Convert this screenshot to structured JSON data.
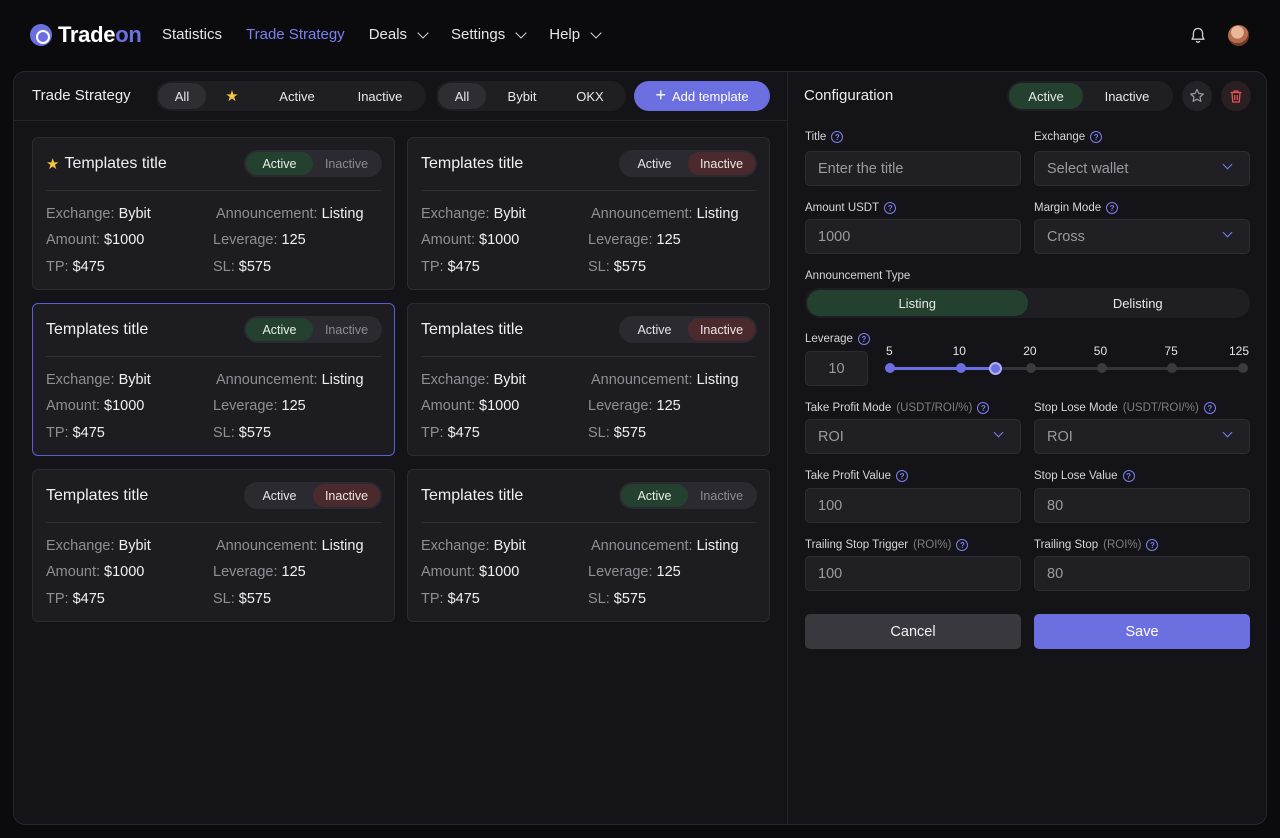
{
  "brand": {
    "name_main": "Trade",
    "name_accent": "on"
  },
  "nav": {
    "items": [
      {
        "label": "Statistics",
        "dropdown": false,
        "active": false
      },
      {
        "label": "Trade Strategy",
        "dropdown": false,
        "active": true
      },
      {
        "label": "Deals",
        "dropdown": true,
        "active": false
      },
      {
        "label": "Settings",
        "dropdown": true,
        "active": false
      },
      {
        "label": "Help",
        "dropdown": true,
        "active": false
      }
    ]
  },
  "strategy": {
    "title": "Trade Strategy",
    "status_filter": {
      "all": "All",
      "active": "Active",
      "inactive": "Inactive"
    },
    "exchange_filter": {
      "all": "All",
      "bybit": "Bybit",
      "okx": "OKX"
    },
    "add_label": "Add template"
  },
  "templates": [
    {
      "title": "Templates title",
      "favorite": true,
      "status": "active",
      "selected": false,
      "exchange_key": "Exchange:",
      "exchange": "Bybit",
      "announcement_key": "Announcement:",
      "announcement": "Listing",
      "amount_key": "Amount:",
      "amount": "$1000",
      "leverage_key": "Leverage:",
      "leverage": "125",
      "tp_key": "TP:",
      "tp": "$475",
      "sl_key": "SL:",
      "sl": "$575",
      "active_label": "Active",
      "inactive_label": "Inactive"
    },
    {
      "title": "Templates title",
      "favorite": false,
      "status": "inactive",
      "selected": false,
      "exchange_key": "Exchange:",
      "exchange": "Bybit",
      "announcement_key": "Announcement:",
      "announcement": "Listing",
      "amount_key": "Amount:",
      "amount": "$1000",
      "leverage_key": "Leverage:",
      "leverage": "125",
      "tp_key": "TP:",
      "tp": "$475",
      "sl_key": "SL:",
      "sl": "$575",
      "active_label": "Active",
      "inactive_label": "Inactive"
    },
    {
      "title": "Templates title",
      "favorite": false,
      "status": "active",
      "selected": true,
      "exchange_key": "Exchange:",
      "exchange": "Bybit",
      "announcement_key": "Announcement:",
      "announcement": "Listing",
      "amount_key": "Amount:",
      "amount": "$1000",
      "leverage_key": "Leverage:",
      "leverage": "125",
      "tp_key": "TP:",
      "tp": "$475",
      "sl_key": "SL:",
      "sl": "$575",
      "active_label": "Active",
      "inactive_label": "Inactive"
    },
    {
      "title": "Templates title",
      "favorite": false,
      "status": "inactive",
      "selected": false,
      "exchange_key": "Exchange:",
      "exchange": "Bybit",
      "announcement_key": "Announcement:",
      "announcement": "Listing",
      "amount_key": "Amount:",
      "amount": "$1000",
      "leverage_key": "Leverage:",
      "leverage": "125",
      "tp_key": "TP:",
      "tp": "$475",
      "sl_key": "SL:",
      "sl": "$575",
      "active_label": "Active",
      "inactive_label": "Inactive"
    },
    {
      "title": "Templates title",
      "favorite": false,
      "status": "inactive",
      "selected": false,
      "exchange_key": "Exchange:",
      "exchange": "Bybit",
      "announcement_key": "Announcement:",
      "announcement": "Listing",
      "amount_key": "Amount:",
      "amount": "$1000",
      "leverage_key": "Leverage:",
      "leverage": "125",
      "tp_key": "TP:",
      "tp": "$475",
      "sl_key": "SL:",
      "sl": "$575",
      "active_label": "Active",
      "inactive_label": "Inactive"
    },
    {
      "title": "Templates title",
      "favorite": false,
      "status": "active",
      "selected": false,
      "exchange_key": "Exchange:",
      "exchange": "Bybit",
      "announcement_key": "Announcement:",
      "announcement": "Listing",
      "amount_key": "Amount:",
      "amount": "$1000",
      "leverage_key": "Leverage:",
      "leverage": "125",
      "tp_key": "TP:",
      "tp": "$475",
      "sl_key": "SL:",
      "sl": "$575",
      "active_label": "Active",
      "inactive_label": "Inactive"
    }
  ],
  "config": {
    "title": "Configuration",
    "status": {
      "active": "Active",
      "inactive": "Inactive"
    },
    "title_label": "Title",
    "title_placeholder": "Enter the title",
    "exchange_label": "Exchange",
    "exchange_placeholder": "Select wallet",
    "amount_label": "Amount USDT",
    "amount_value": "1000",
    "margin_label": "Margin Mode",
    "margin_value": "Cross",
    "announcement_label": "Announcement Type",
    "announcement_options": {
      "listing": "Listing",
      "delisting": "Delisting"
    },
    "leverage_label": "Leverage",
    "leverage_value": "10",
    "leverage_ticks": [
      "5",
      "10",
      "20",
      "50",
      "75",
      "125"
    ],
    "leverage_selected_index": 1.5,
    "tp_mode_label": "Take Profit Mode",
    "tp_mode_hint": "(USDT/ROI/%)",
    "tp_mode_value": "ROI",
    "sl_mode_label": "Stop Lose Mode",
    "sl_mode_hint": "(USDT/ROI/%)",
    "sl_mode_value": "ROI",
    "tp_value_label": "Take Profit Value",
    "tp_value": "100",
    "sl_value_label": "Stop Lose Value",
    "sl_value": "80",
    "trail_trigger_label": "Trailing Stop Trigger",
    "trail_trigger_hint": "(ROI%)",
    "trail_trigger_value": "100",
    "trail_label": "Trailing Stop",
    "trail_hint": "(ROI%)",
    "trail_value": "80",
    "cancel_label": "Cancel",
    "save_label": "Save"
  },
  "colors": {
    "accent": "#6b6fe0",
    "active_bg": "#24402f",
    "inactive_bg": "#4a2a2c",
    "star": "#f2c744"
  }
}
